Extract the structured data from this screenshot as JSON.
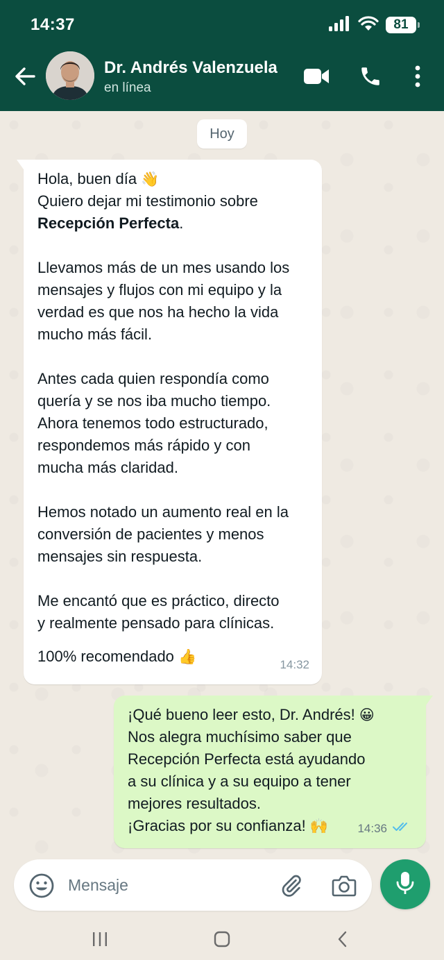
{
  "status_bar": {
    "time": "14:37",
    "battery": "81"
  },
  "header": {
    "contact_name": "Dr. Andrés Valenzuela",
    "contact_status": "en línea",
    "colors": {
      "header_bg": "#0b4d3f"
    },
    "icons": [
      "back-arrow-icon",
      "avatar",
      "video-call-icon",
      "phone-icon",
      "more-options-icon"
    ]
  },
  "chat": {
    "date_label": "Hoy",
    "incoming": {
      "line1": "Hola, buen día",
      "line1_emoji": "👋",
      "line2": "Quiero dejar mi testimonio sobre",
      "line3_bold": "Recepción Perfecta",
      "line3_end": ".",
      "para2": [
        "Llevamos más de un mes usando los",
        "mensajes y flujos con mi equipo y la",
        "verdad es que nos ha hecho la vida",
        "mucho más fácil."
      ],
      "para3": [
        "Antes cada quien respondía como",
        "quería y se nos iba mucho tiempo.",
        "Ahora tenemos todo estructurado,",
        "respondemos más rápido y con",
        "mucha más claridad."
      ],
      "para4": [
        "Hemos notado un aumento real en la",
        "conversión de pacientes y menos",
        "mensajes sin respuesta."
      ],
      "para5": [
        "Me encantó que es práctico, directo",
        "y realmente pensado para clínicas."
      ],
      "last_line": "100% recomendado",
      "last_emoji": "👍",
      "time": "14:32"
    },
    "outgoing": {
      "line1": "¡Qué bueno leer esto, Dr. Andrés!",
      "line1_emoji": "😀",
      "lines": [
        "Nos alegra muchísimo saber que",
        "Recepción Perfecta está ayudando",
        "a su clínica y a su equipo a tener",
        "mejores resultados."
      ],
      "last_line": "¡Gracias por su confianza!",
      "last_emoji": "🙌",
      "time": "14:36",
      "status": "read",
      "colors": {
        "bubble": "#dcf8c6",
        "read_ticks": "#53bdeb"
      }
    }
  },
  "composer": {
    "placeholder": "Mensaje",
    "icons": [
      "emoji-icon",
      "attach-icon",
      "camera-icon",
      "mic-icon"
    ],
    "colors": {
      "mic_button": "#1f9e6e"
    }
  },
  "nav": {
    "icons": [
      "recent-apps-icon",
      "home-icon",
      "back-nav-icon"
    ]
  }
}
